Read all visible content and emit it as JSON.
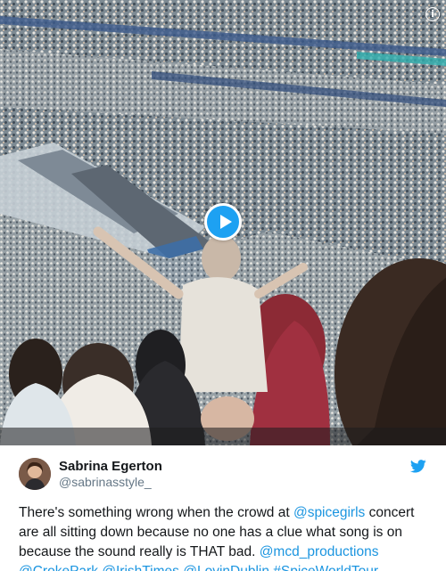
{
  "media": {
    "info_icon_glyph": "i",
    "play_icon": "play-icon"
  },
  "tweet": {
    "author": {
      "name": "Sabrina Egerton",
      "handle": "@sabrinasstyle_"
    },
    "text_parts": {
      "p1": "There's something wrong when the crowd at ",
      "m1": "@spicegirls",
      "p2": " concert are all sitting down because no one has a clue what song is on because the sound really is THAT bad. ",
      "m2": "@mcd_productions",
      "sp1": " ",
      "m3": "@CrokePark",
      "sp2": " ",
      "m4": "@IrishTimes",
      "sp3": " ",
      "m5": "@LovinDublin",
      "sp4": " ",
      "m6": "#SpiceWorldTour"
    }
  },
  "colors": {
    "link": "#1b95e0",
    "brand": "#1da1f2",
    "handle": "#657786"
  }
}
